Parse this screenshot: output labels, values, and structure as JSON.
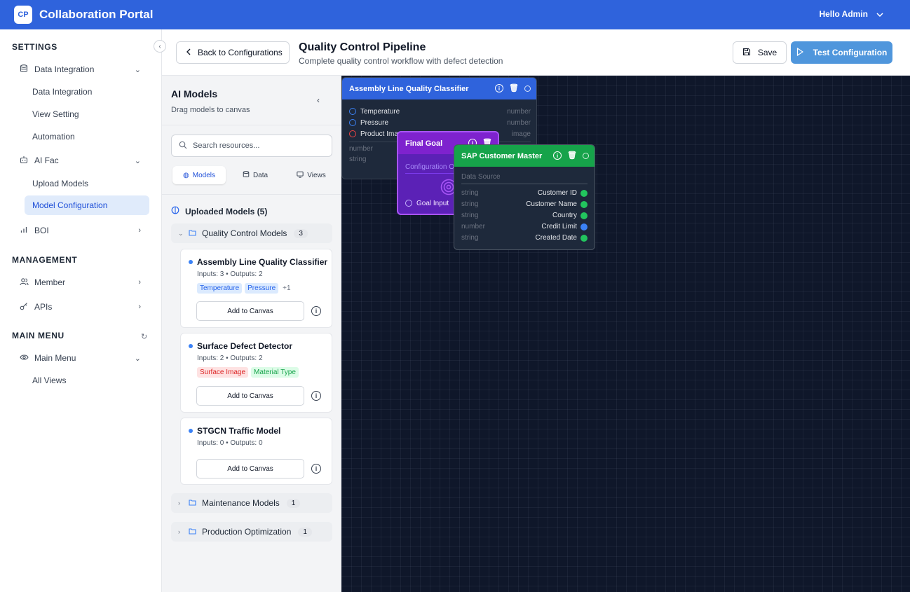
{
  "app": {
    "logo": "CP",
    "title": "Collaboration Portal",
    "user_greeting": "Hello Admin"
  },
  "sidebar": {
    "collapse_icon": "chevron-left",
    "sections": {
      "settings": "SETTINGS",
      "management": "MANAGEMENT",
      "main_menu": "MAIN MENU"
    },
    "data_integration": "Data Integration",
    "data_integration_children": [
      "Data Integration",
      "View Setting",
      "Automation"
    ],
    "ai_fac": "AI Fac",
    "ai_fac_children": [
      "Upload Models",
      "Model Configuration"
    ],
    "boi": "BOI",
    "member": "Member",
    "apis": "APIs",
    "main_menu_item": "Main Menu",
    "main_menu_children": [
      "All Views"
    ]
  },
  "header": {
    "back_label": "Back to Configurations",
    "title": "Quality Control Pipeline",
    "subtitle": "Complete quality control workflow with defect detection",
    "save_label": "Save",
    "test_label": "Test Configuration"
  },
  "panel": {
    "title": "AI Models",
    "subtitle": "Drag models to canvas",
    "search_placeholder": "Search resources...",
    "tabs": [
      "Models",
      "Data",
      "Views"
    ],
    "uploaded_label": "Uploaded Models (5)",
    "folders": [
      {
        "name": "Quality Control Models",
        "count": "3"
      },
      {
        "name": "Maintenance Models",
        "count": "1"
      },
      {
        "name": "Production Optimization",
        "count": "1"
      }
    ],
    "models": [
      {
        "name": "Assembly Line Quality Classifier",
        "io": "Inputs: 3 • Outputs: 2",
        "tags": [
          "Temperature",
          "Pressure"
        ],
        "more": "+1",
        "add_label": "Add to Canvas"
      },
      {
        "name": "Surface Defect Detector",
        "io": "Inputs: 2 • Outputs: 2",
        "tags": [
          "Surface Image",
          "Material Type"
        ],
        "add_label": "Add to Canvas"
      },
      {
        "name": "STGCN Traffic Model",
        "io": "Inputs: 0 • Outputs: 0",
        "tags": [],
        "add_label": "Add to Canvas"
      }
    ]
  },
  "canvas": {
    "node_classifier": {
      "title": "Assembly Line Quality Classifier",
      "inputs": [
        {
          "name": "Temperature",
          "type": "number"
        },
        {
          "name": "Pressure",
          "type": "number"
        },
        {
          "name": "Product Image",
          "type": "image"
        }
      ],
      "outputs": [
        {
          "type": "number"
        },
        {
          "type": "string"
        }
      ]
    },
    "node_goal": {
      "title": "Final Goal",
      "config_label": "Configuration O",
      "input_label": "Goal Input"
    },
    "node_sap": {
      "title": "SAP Customer Master",
      "section": "Data Source",
      "fields": [
        {
          "type": "string",
          "name": "Customer ID"
        },
        {
          "type": "string",
          "name": "Customer Name"
        },
        {
          "type": "string",
          "name": "Country"
        },
        {
          "type": "number",
          "name": "Credit Limit"
        },
        {
          "type": "string",
          "name": "Created Date"
        }
      ]
    }
  },
  "colors": {
    "brand": "#2f63dc",
    "canvas_bg": "#0f172a",
    "goal": "#7e22ce",
    "data": "#16a34a"
  }
}
